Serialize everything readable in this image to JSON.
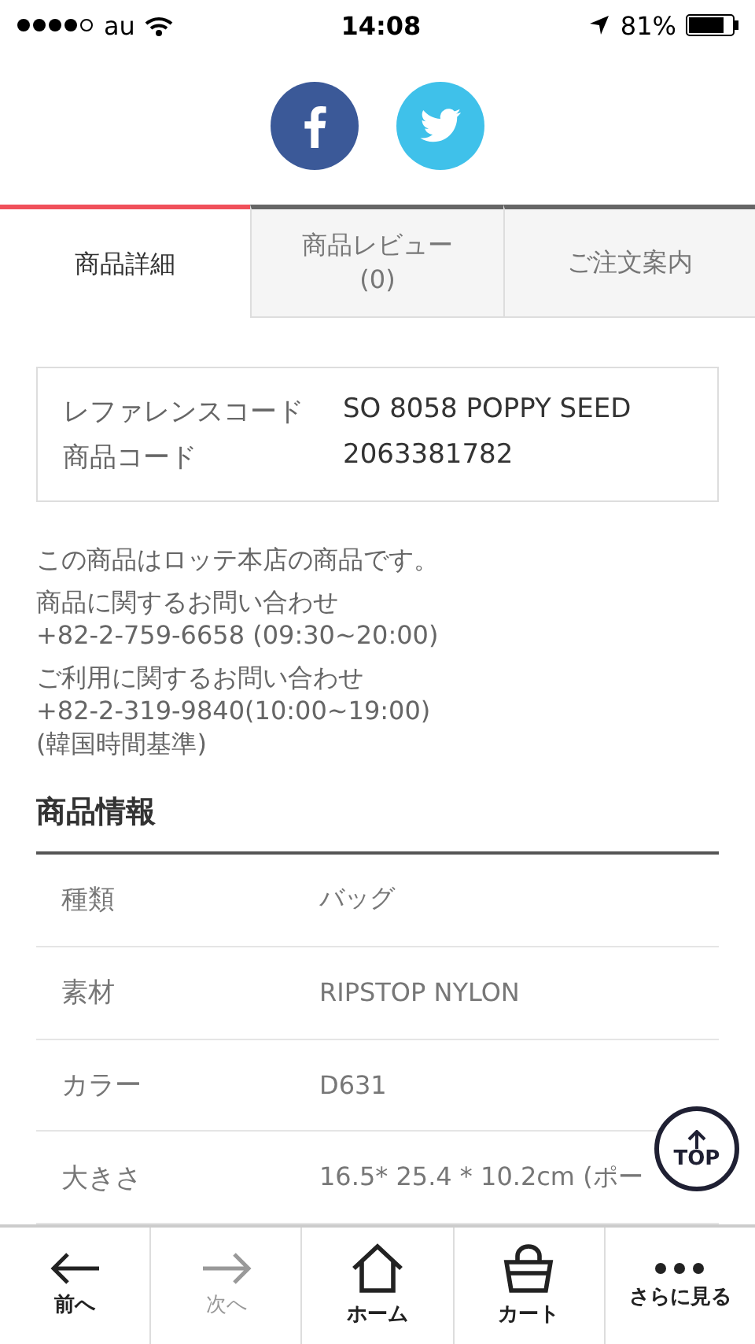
{
  "status_bar": {
    "carrier": "au",
    "time": "14:08",
    "battery": "81%"
  },
  "tabs": [
    {
      "label": "商品詳細",
      "selected": true
    },
    {
      "label": "商品レビュー\n(0)",
      "selected": false
    },
    {
      "label": "ご注文案内",
      "selected": false
    }
  ],
  "codes": [
    {
      "label": "レファレンスコード",
      "value": "SO 8058 POPPY SEED"
    },
    {
      "label": "商品コード",
      "value": "2063381782"
    }
  ],
  "notice": [
    "この商品はロッテ本店の商品です。",
    "商品に関するお問い合わせ\n+82-2-759-6658 (09:30~20:00)",
    "ご利用に関するお問い合わせ\n+82-2-319-9840(10:00~19:00)\n(韓国時間基準)"
  ],
  "product_info": {
    "title": "商品情報",
    "rows": [
      {
        "label": "種類",
        "value": "バッグ"
      },
      {
        "label": "素材",
        "value": "RIPSTOP NYLON"
      },
      {
        "label": "カラー",
        "value": "D631"
      },
      {
        "label": "大きさ",
        "value": "16.5* 25.4 * 10.2cm (ポー"
      }
    ]
  },
  "top_button": {
    "label": "TOP"
  },
  "bottom_nav": [
    {
      "kind": "back",
      "label": "前へ",
      "disabled": false
    },
    {
      "kind": "forward",
      "label": "次へ",
      "disabled": true
    },
    {
      "kind": "home",
      "label": "ホーム",
      "disabled": false
    },
    {
      "kind": "cart",
      "label": "カート",
      "disabled": false
    },
    {
      "kind": "more",
      "label": "さらに見る",
      "disabled": false
    }
  ]
}
